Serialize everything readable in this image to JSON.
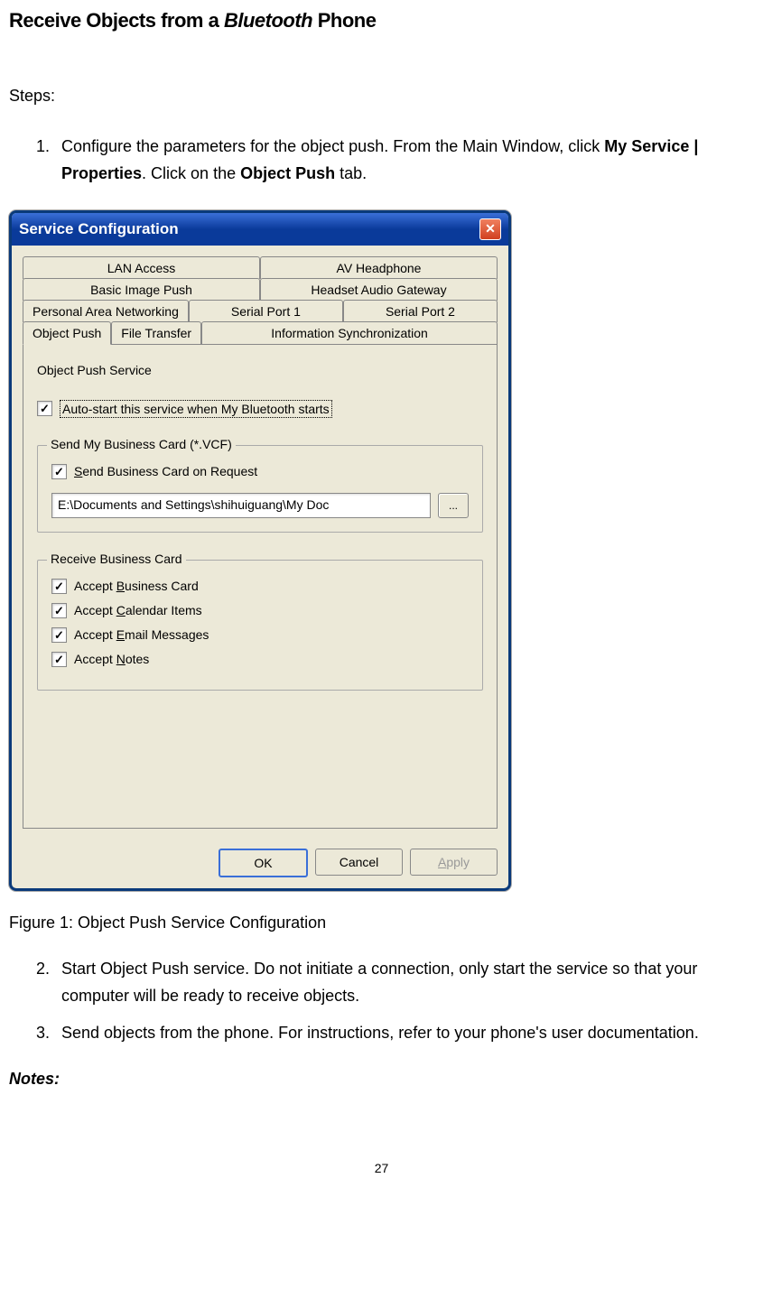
{
  "title_prefix": "Receive Objects from a ",
  "title_italic": "Bluetooth",
  "title_suffix": " Phone",
  "steps_label": "Steps:",
  "step1_a": "Configure the parameters for the object push. From the Main Window, click ",
  "step1_b": "My Service | Properties",
  "step1_c": ". Click on the ",
  "step1_d": " Object Push",
  "step1_e": " tab.",
  "dialog": {
    "title": "Service Configuration",
    "tabs_row1": [
      "LAN Access",
      "AV Headphone"
    ],
    "tabs_row2": [
      "Basic Image Push",
      "Headset Audio Gateway"
    ],
    "tabs_row3": [
      "Personal Area Networking",
      "Serial Port 1",
      "Serial Port 2"
    ],
    "tabs_row4": [
      "Object Push",
      "File Transfer",
      "Information Synchronization"
    ],
    "group_title": "Object Push Service",
    "autostart": "Auto-start this service when My Bluetooth starts",
    "send_group": "Send My Business Card (*.VCF)",
    "send_check_pre": "S",
    "send_check": "end Business Card on Request",
    "path": "E:\\Documents and Settings\\shihuiguang\\My Doc",
    "browse": "...",
    "receive_group": "Receive Business Card",
    "accept_business_pre": "Accept ",
    "accept_business_u": "B",
    "accept_business_post": "usiness Card",
    "accept_calendar_pre": "Accept ",
    "accept_calendar_u": "C",
    "accept_calendar_post": "alendar Items",
    "accept_email_pre": "Accept ",
    "accept_email_u": "E",
    "accept_email_post": "mail Messages",
    "accept_notes_pre": "Accept ",
    "accept_notes_u": "N",
    "accept_notes_post": "otes",
    "ok": "OK",
    "cancel": "Cancel",
    "apply_u": "A",
    "apply_post": "pply"
  },
  "figure_caption": "Figure 1: Object Push Service Configuration",
  "step2": "Start Object Push service. Do not initiate a connection, only start the service so that your computer will be ready to receive objects.",
  "step3": "Send objects from the phone. For instructions, refer to your phone's user documentation.",
  "notes_label": "Notes:",
  "page_number": "27"
}
